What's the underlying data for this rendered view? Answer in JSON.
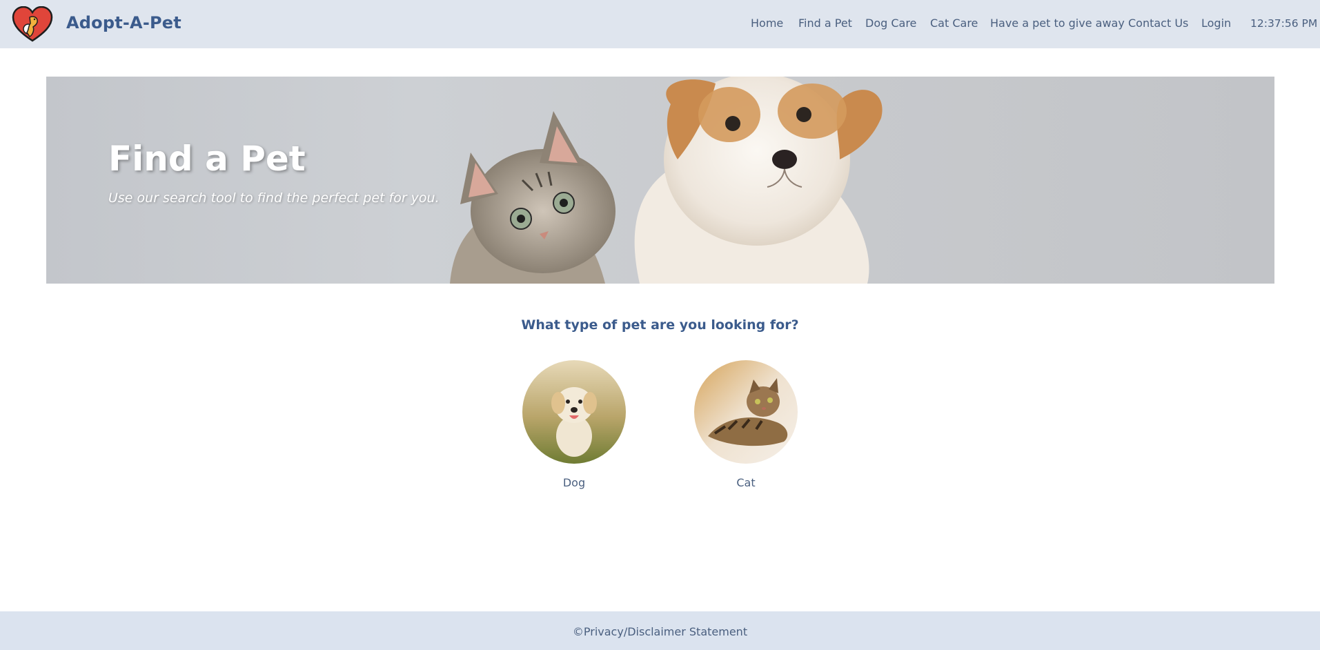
{
  "header": {
    "brand": "Adopt-A-Pet",
    "nav": [
      "Home",
      "Find a Pet",
      "Dog Care",
      "Cat Care",
      "Have a pet to give away",
      "Contact Us",
      "Login"
    ],
    "clock": "12:37:56 PM"
  },
  "hero": {
    "title": "Find a Pet",
    "subtitle": "Use our search tool to find the perfect pet for you."
  },
  "search": {
    "question": "What type of pet are you looking for?",
    "options": [
      {
        "label": "Dog",
        "icon": "dog-photo"
      },
      {
        "label": "Cat",
        "icon": "cat-photo"
      }
    ]
  },
  "footer": {
    "text": "©Privacy/Disclaimer Statement"
  },
  "colors": {
    "topbar": "#dfe5ee",
    "brand": "#3b5b8c",
    "nav": "#4a5f7f",
    "footer": "#dbe3ef",
    "logo_heart": "#e0453a"
  }
}
